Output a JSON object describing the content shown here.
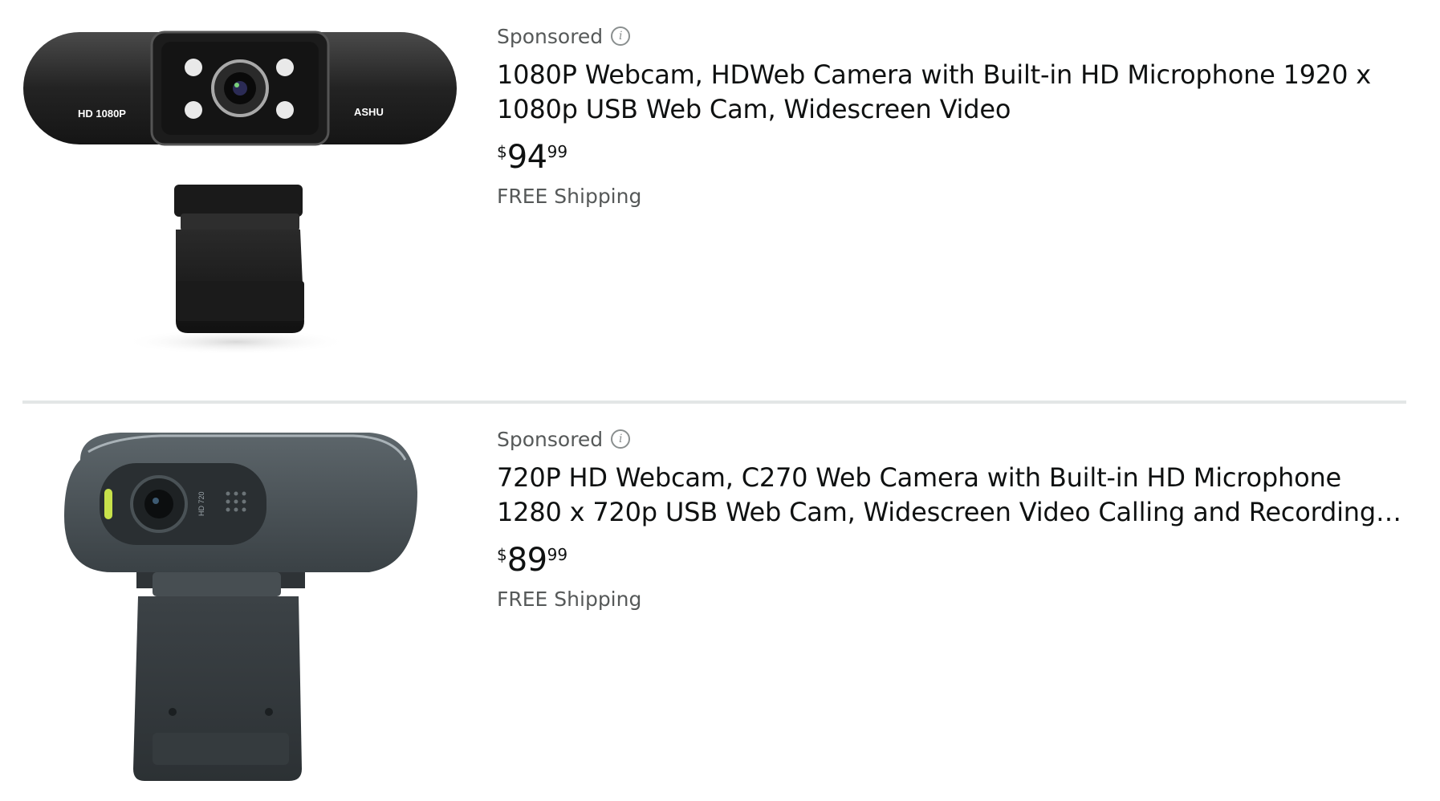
{
  "results": [
    {
      "sponsored_label": "Sponsored",
      "info_glyph": "i",
      "title": "1080P Webcam, HDWeb Camera with Built-in HD Microphone 1920 x 1080p USB Web Cam, Widescreen Video",
      "price": {
        "symbol": "$",
        "whole": "94",
        "fraction": "99"
      },
      "shipping": "FREE Shipping",
      "image": {
        "icon": "webcam-1080p-image",
        "left_text": "HD 1080P",
        "right_text": "ASHU"
      }
    },
    {
      "sponsored_label": "Sponsored",
      "info_glyph": "i",
      "title": "720P HD Webcam, C270 Web Camera with Built-in HD Microphone 1280 x 720p USB Web Cam, Widescreen Video Calling and Recording, USB...",
      "price": {
        "symbol": "$",
        "whole": "89",
        "fraction": "99"
      },
      "shipping": "FREE Shipping",
      "image": {
        "icon": "webcam-720p-image",
        "side_text": "HD 720"
      }
    }
  ],
  "colors": {
    "text": "#0f1111",
    "secondary_text": "#565959",
    "divider": "#e3e6e6"
  }
}
